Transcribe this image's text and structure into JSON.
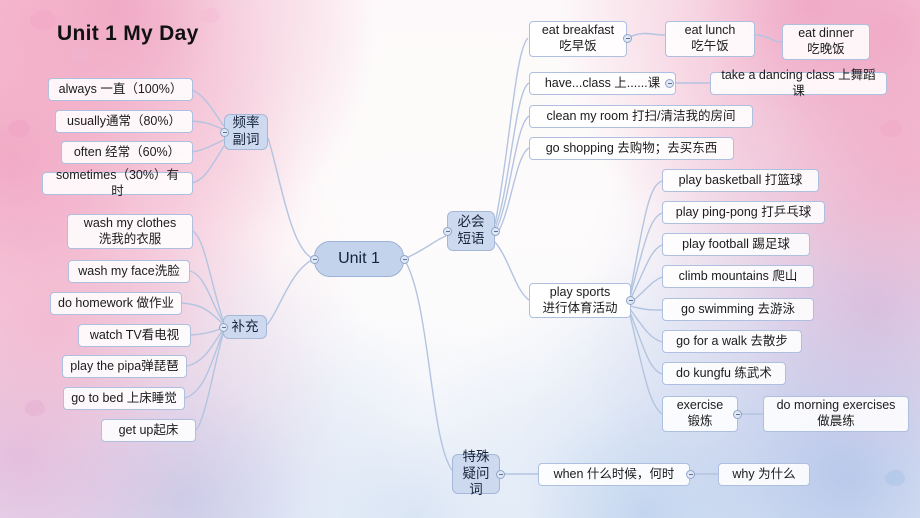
{
  "title": "Unit 1  My Day",
  "center": {
    "label": "Unit 1"
  },
  "branches": {
    "frequency": {
      "label": "频率\n副词"
    },
    "supplement": {
      "label": "补充"
    },
    "phrases": {
      "label": "必会\n短语"
    },
    "question": {
      "label": "特殊\n疑问词"
    }
  },
  "frequency_items": [
    {
      "label": "always  一直（100%）"
    },
    {
      "label": "usually通常（80%）"
    },
    {
      "label": "often 经常（60%）"
    },
    {
      "label": "sometimes（30%）有时"
    }
  ],
  "supplement_items": [
    {
      "label": "wash my clothes\n洗我的衣服"
    },
    {
      "label": "wash my face洗脸"
    },
    {
      "label": "do homework 做作业"
    },
    {
      "label": "watch TV看电视"
    },
    {
      "label": "play the pipa弹琵琶"
    },
    {
      "label": "go to bed 上床睡觉"
    },
    {
      "label": "get  up起床"
    }
  ],
  "phrase_items": [
    {
      "label": "eat breakfast\n吃早饭"
    },
    {
      "label": "have...class 上......课"
    },
    {
      "label": "clean my room 打扫/清洁我的房间"
    },
    {
      "label": "go shopping 去购物；去买东西"
    },
    {
      "label": "play sports\n进行体育活动"
    }
  ],
  "breakfast_children": [
    {
      "label": "eat  lunch\n吃午饭"
    },
    {
      "label": "eat dinner\n吃晚饭"
    }
  ],
  "class_children": [
    {
      "label": "take a dancing class 上舞蹈课"
    }
  ],
  "sports_items": [
    {
      "label": "play  basketball 打篮球"
    },
    {
      "label": "play ping-pong 打乒乓球"
    },
    {
      "label": "play football 踢足球"
    },
    {
      "label": "climb mountains 爬山"
    },
    {
      "label": "go swimming 去游泳"
    },
    {
      "label": "go for a walk 去散步"
    },
    {
      "label": "do kungfu 练武术"
    },
    {
      "label": "exercise\n锻炼"
    }
  ],
  "exercise_children": [
    {
      "label": "do morning exercises\n做晨练"
    }
  ],
  "question_items": [
    {
      "label": "when 什么时候，何时"
    }
  ],
  "question_children": [
    {
      "label": "why 为什么"
    }
  ],
  "colors": {
    "center_fill": "#c3d3ec",
    "branch_fill": "#cdd9ee",
    "node_border": "#aebfe0",
    "link": "#b3c4e0"
  }
}
